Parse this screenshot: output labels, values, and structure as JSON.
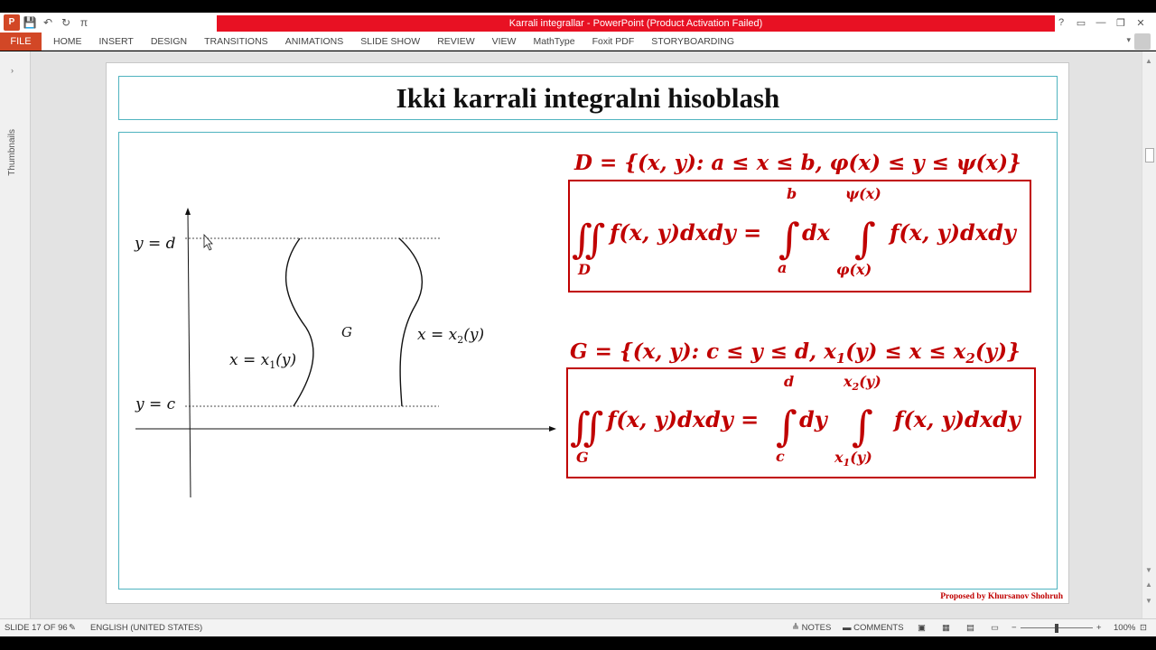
{
  "window": {
    "title": "Karrali integrallar -  PowerPoint (Product Activation Failed)"
  },
  "qat": {
    "app_icon": "P",
    "save_icon": "💾",
    "undo_icon": "↶",
    "redo_icon": "↻",
    "pi_icon": "π"
  },
  "window_controls": {
    "help": "?",
    "ribbon_display": "▭",
    "minimize": "—",
    "restore": "❐",
    "close": "✕"
  },
  "ribbon": {
    "file": "FILE",
    "tabs": [
      "HOME",
      "INSERT",
      "DESIGN",
      "TRANSITIONS",
      "ANIMATIONS",
      "SLIDE SHOW",
      "REVIEW",
      "VIEW",
      "MathType",
      "Foxit PDF",
      "STORYBOARDING"
    ]
  },
  "thumbnails": {
    "label": "Thumbnails",
    "toggle": "›"
  },
  "slide": {
    "title": "Ikki karrali integralni hisoblash",
    "credit": "Proposed by Khursanov Shohruh",
    "diagram": {
      "label_y_d": "y = d",
      "label_y_c": "y = c",
      "label_G": "G",
      "left_curve": "x = x",
      "left_sub": "1",
      "left_arg": "(y)",
      "right_curve": "x = x",
      "right_sub": "2",
      "right_arg": "(y)"
    },
    "formula1": {
      "domain": "D = {(x, y): a ≤ x ≤ b, φ(x) ≤ y ≤ ψ(x)}",
      "integral_sign": "∬",
      "lhs": "f(x, y)dxdy =",
      "region": "D",
      "outer_sign": "∫",
      "outer_upper": "b",
      "outer_lower": "a",
      "outer_var": "dx",
      "inner_sign": "∫",
      "inner_upper": "ψ(x)",
      "inner_lower": "φ(x)",
      "integrand": "f(x, y)dxdy"
    },
    "formula2": {
      "domain_prefix": "G = {(x, y): c ≤ y ≤ d, x",
      "domain_sub1": "1",
      "domain_mid": "(y) ≤ x ≤ x",
      "domain_sub2": "2",
      "domain_end": "(y)}",
      "integral_sign": "∬",
      "lhs": "f(x, y)dxdy =",
      "region": "G",
      "outer_sign": "∫",
      "outer_upper": "d",
      "outer_lower": "c",
      "outer_var": "dy",
      "inner_sign": "∫",
      "inner_upper": "x",
      "inner_upper_sub": "2",
      "inner_upper_arg": "(y)",
      "inner_lower": "x",
      "inner_lower_sub": "1",
      "inner_lower_arg": "(y)",
      "integrand": "f(x, y)dxdy"
    }
  },
  "statusbar": {
    "slide_info": "SLIDE 17 OF 96",
    "language": "ENGLISH (UNITED STATES)",
    "notes": "≜ NOTES",
    "comments": "▬ COMMENTS",
    "zoom_minus": "−",
    "zoom_plus": "+",
    "zoom_level": "100%"
  },
  "colors": {
    "accent": "#d24726",
    "title_bar": "#e81123",
    "frame": "#4fb3bf",
    "formula": "#c00000"
  }
}
